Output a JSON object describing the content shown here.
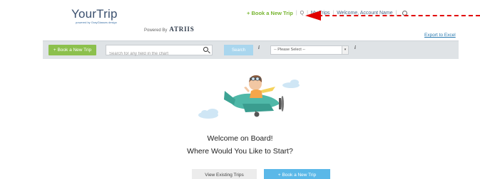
{
  "header": {
    "logo_text": "YourTrip",
    "logo_tagline": "powered by GrayGlasses design",
    "powered_by_label": "Powered By",
    "powered_by_brand": "ATRIIS",
    "nav": {
      "book_new_trip": "+ Book a New Trip",
      "link_1": "Q",
      "link_2": "My Trips",
      "link_3": "Welcome, Account Name",
      "link_4": "",
      "user_icon": "user-icon"
    },
    "export": "Export to Excel"
  },
  "toolbar": {
    "book_new_trip": "+ Book a New Trip",
    "search_placeholder": "Search for any field in the chart",
    "search_button": "Search",
    "select_value": "-- Please Select --"
  },
  "main": {
    "welcome_line_1": "Welcome on Board!",
    "welcome_line_2": "Where Would You Like to Start?",
    "view_existing_trips": "View Existing Trips",
    "book_new_trip": "+ Book a New Trip"
  },
  "annotation": {
    "arrow_color": "#e10000"
  },
  "colors": {
    "green": "#8cc04d",
    "blue": "#5bb8e8",
    "toolbar_bg": "#dfe3e6"
  }
}
